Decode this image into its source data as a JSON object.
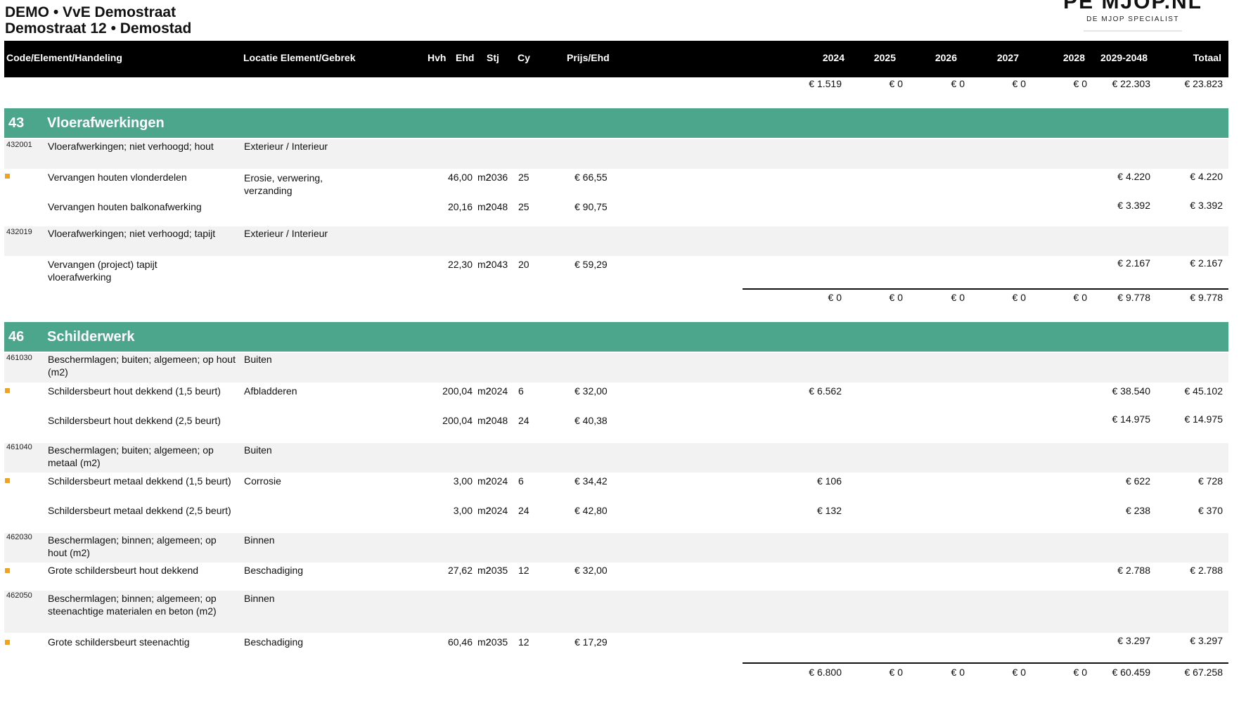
{
  "header": {
    "line1": "DEMO • VvE Demostraat",
    "line2": "Demostraat 12 • Demostad",
    "brand": "PE MJOP.NL",
    "brand_tagline": "DE MJOP SPECIALIST"
  },
  "columns": {
    "code": "Code/Element/Handeling",
    "locatie": "Locatie Element/Gebrek",
    "hvh": "Hvh",
    "ehd": "Ehd",
    "stj": "Stj",
    "cy": "Cy",
    "prijs": "Prijs/Ehd",
    "y2024": "2024",
    "y2025": "2025",
    "y2026": "2026",
    "y2027": "2027",
    "y2028": "2028",
    "y2029": "2029-2048",
    "totaal": "Totaal"
  },
  "carry_totals": [
    "€ 1.519",
    "€ 0",
    "€ 0",
    "€ 0",
    "€ 0",
    "€ 22.303",
    "€ 23.823"
  ],
  "sections": [
    {
      "num": "43",
      "name": "Vloerafwerkingen",
      "elements": [
        {
          "code": "432001",
          "desc": "Vloerafwerkingen; niet verhoogd; hout",
          "locatie": "Exterieur / Interieur",
          "actions": [
            {
              "desc": "Vervangen houten vlonderdelen",
              "locatie": "Erosie, verwering, verzanding",
              "hvh": "46,00",
              "ehd": "m2",
              "stj": "2036",
              "cy": "25",
              "prijs": "€ 66,55",
              "y2024": "",
              "y2029": "€ 4.220",
              "totaal": "€ 4.220",
              "marker": true
            },
            {
              "desc": "Vervangen houten balkonafwerking",
              "locatie": "",
              "hvh": "20,16",
              "ehd": "m2",
              "stj": "2048",
              "cy": "25",
              "prijs": "€ 90,75",
              "y2024": "",
              "y2029": "€ 3.392",
              "totaal": "€ 3.392",
              "marker": false
            }
          ]
        },
        {
          "code": "432019",
          "desc": "Vloerafwerkingen; niet verhoogd; tapijt",
          "locatie": "Exterieur / Interieur",
          "actions": [
            {
              "desc": "Vervangen (project) tapijt vloerafwerking",
              "locatie": "",
              "hvh": "22,30",
              "ehd": "m2",
              "stj": "2043",
              "cy": "20",
              "prijs": "€ 59,29",
              "y2024": "",
              "y2029": "€ 2.167",
              "totaal": "€ 2.167",
              "marker": false
            }
          ]
        }
      ],
      "totals": [
        "€ 0",
        "€ 0",
        "€ 0",
        "€ 0",
        "€ 0",
        "€ 9.778",
        "€ 9.778"
      ]
    },
    {
      "num": "46",
      "name": "Schilderwerk",
      "elements": [
        {
          "code": "461030",
          "desc": "Beschermlagen; buiten; algemeen; op hout (m2)",
          "locatie": "Buiten",
          "actions": [
            {
              "desc": "Schildersbeurt hout dekkend (1,5 beurt)",
              "locatie": "Afbladderen",
              "hvh": "200,04",
              "ehd": "m2",
              "stj": "2024",
              "cy": "6",
              "prijs": "€ 32,00",
              "y2024": "€ 6.562",
              "y2029": "€ 38.540",
              "totaal": "€ 45.102",
              "marker": true
            },
            {
              "desc": "Schildersbeurt hout dekkend (2,5 beurt)",
              "locatie": "",
              "hvh": "200,04",
              "ehd": "m2",
              "stj": "2048",
              "cy": "24",
              "prijs": "€ 40,38",
              "y2024": "",
              "y2029": "€ 14.975",
              "totaal": "€ 14.975",
              "marker": false
            }
          ]
        },
        {
          "code": "461040",
          "desc": "Beschermlagen; buiten; algemeen; op metaal (m2)",
          "locatie": "Buiten",
          "actions": [
            {
              "desc": "Schildersbeurt metaal dekkend (1,5 beurt)",
              "locatie": "Corrosie",
              "hvh": "3,00",
              "ehd": "m2",
              "stj": "2024",
              "cy": "6",
              "prijs": "€ 34,42",
              "y2024": "€ 106",
              "y2029": "€ 622",
              "totaal": "€ 728",
              "marker": true
            },
            {
              "desc": "Schildersbeurt metaal dekkend (2,5 beurt)",
              "locatie": "",
              "hvh": "3,00",
              "ehd": "m2",
              "stj": "2024",
              "cy": "24",
              "prijs": "€ 42,80",
              "y2024": "€ 132",
              "y2029": "€ 238",
              "totaal": "€ 370",
              "marker": false
            }
          ]
        },
        {
          "code": "462030",
          "desc": "Beschermlagen; binnen; algemeen; op hout (m2)",
          "locatie": "Binnen",
          "actions": [
            {
              "desc": "Grote schildersbeurt hout dekkend",
              "locatie": "Beschadiging",
              "hvh": "27,62",
              "ehd": "m2",
              "stj": "2035",
              "cy": "12",
              "prijs": "€ 32,00",
              "y2024": "",
              "y2029": "€ 2.788",
              "totaal": "€ 2.788",
              "marker": true
            }
          ]
        },
        {
          "code": "462050",
          "desc": "Beschermlagen; binnen; algemeen; op steenachtige materialen en beton (m2)",
          "locatie": "Binnen",
          "actions": [
            {
              "desc": "Grote schildersbeurt steenachtig",
              "locatie": "Beschadiging",
              "hvh": "60,46",
              "ehd": "m2",
              "stj": "2035",
              "cy": "12",
              "prijs": "€ 17,29",
              "y2024": "",
              "y2029": "€ 3.297",
              "totaal": "€ 3.297",
              "marker": true
            }
          ]
        }
      ],
      "totals": [
        "€ 6.800",
        "€ 0",
        "€ 0",
        "€ 0",
        "€ 0",
        "€ 60.459",
        "€ 67.258"
      ]
    }
  ],
  "colors": {
    "header_bg": "#000000",
    "section_bg": "#4ba68c",
    "row_band": "#f2f2f2",
    "marker": "#f2a31a"
  }
}
